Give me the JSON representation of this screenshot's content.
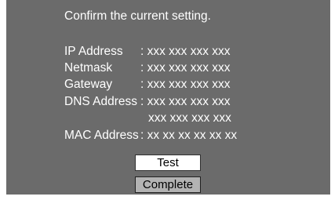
{
  "dialog": {
    "heading": "Confirm the current setting.",
    "rows": [
      {
        "label": "IP Address",
        "value": ": xxx xxx xxx xxx"
      },
      {
        "label": "Netmask",
        "value": ": xxx xxx xxx xxx"
      },
      {
        "label": "Gateway",
        "value": ": xxx xxx xxx xxx"
      },
      {
        "label": "DNS Address",
        "value": ": xxx xxx xxx xxx"
      },
      {
        "label": "",
        "value": "xxx xxx xxx xxx"
      },
      {
        "label": "MAC Address",
        "value": ": xx xx xx xx xx xx"
      }
    ],
    "buttons": {
      "test_label": "Test",
      "complete_label": "Complete"
    }
  },
  "colors": {
    "panel_bg": "#6b6b6b",
    "text": "#ffffff",
    "button_bg": "#ffffff",
    "button_selected_bg": "#b3b3b3"
  }
}
